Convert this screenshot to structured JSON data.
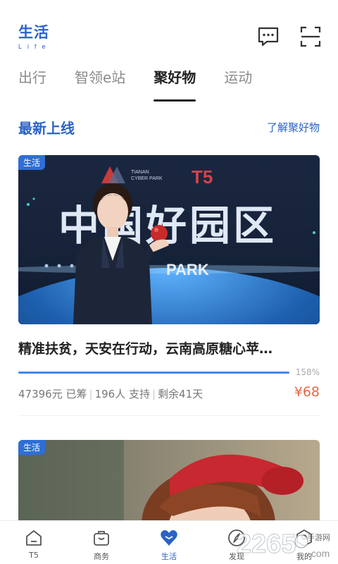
{
  "header": {
    "brand_title": "生活",
    "brand_sub": "Life",
    "message_icon": "chat-bubble-icon",
    "scan_icon": "scan-icon"
  },
  "tabs": [
    {
      "label": "出行",
      "active": false
    },
    {
      "label": "智领e站",
      "active": false
    },
    {
      "label": "聚好物",
      "active": true
    },
    {
      "label": "运动",
      "active": false
    }
  ],
  "section": {
    "title": "最新上线",
    "link": "了解聚好物"
  },
  "cards": [
    {
      "badge": "生活",
      "image_text": "中国好园区",
      "image_park_text": "PARK",
      "image_logo_text": "T5",
      "title": "精准扶贫，天安在行动，云南高原糖心苹…",
      "progress_percent": 100,
      "progress_label": "158%",
      "raised": "47396元 已筹",
      "supporters": "196人 支持",
      "remaining": "剩余41天",
      "price": "¥68"
    },
    {
      "badge": "生活"
    }
  ],
  "bottom_nav": [
    {
      "label": "T5",
      "icon": "home-icon",
      "active": false
    },
    {
      "label": "商务",
      "icon": "briefcase-icon",
      "active": false
    },
    {
      "label": "生活",
      "icon": "heart-icon",
      "active": true
    },
    {
      "label": "发现",
      "icon": "compass-icon",
      "active": false
    },
    {
      "label": "我的",
      "icon": "user-icon",
      "active": false
    }
  ],
  "watermark": {
    "text": "2265",
    "sub": "手游网",
    "suffix": ".com"
  },
  "colors": {
    "accent": "#2b63c6",
    "price": "#e8683f",
    "progress": "#4a86e8"
  }
}
